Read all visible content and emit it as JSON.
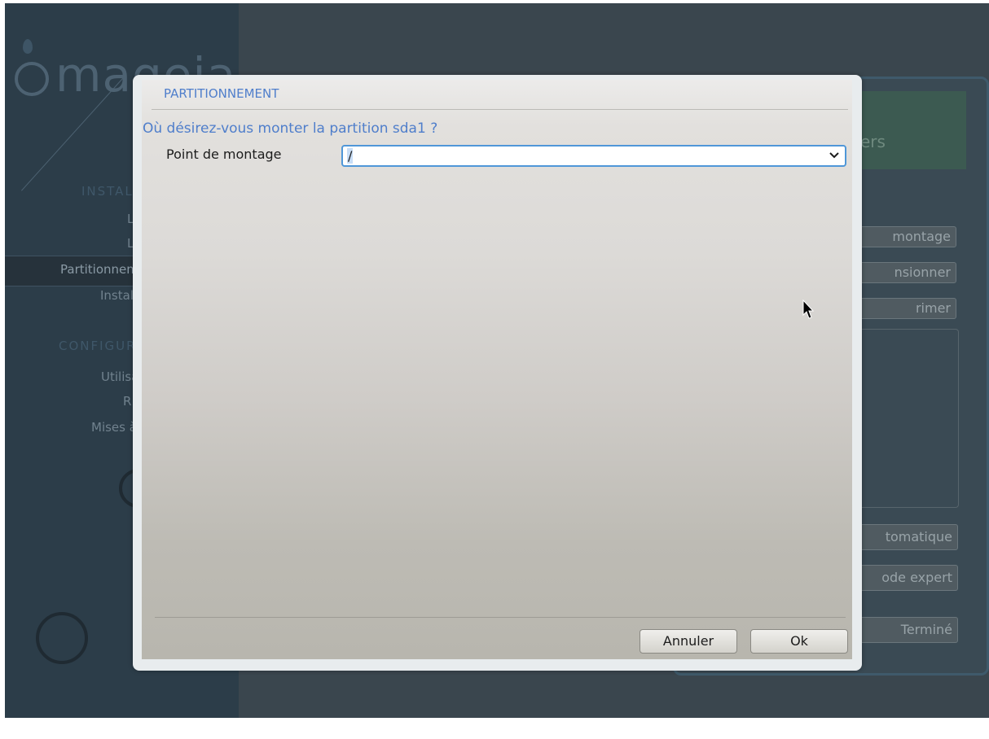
{
  "background": {
    "logo_text": "mageia",
    "sidebar_headings": [
      "INSTALLATION",
      "CONFIGURATION"
    ],
    "sidebar_items_visible": [
      "L",
      "L",
      "Partitionnement",
      "Installation",
      "Utilisateurs",
      "R",
      "Mises à jour"
    ],
    "main_header": "ers",
    "main_buttons": [
      "montage",
      "nsionner",
      "rimer",
      "tomatique",
      "ode expert",
      "Terminé"
    ]
  },
  "dialog": {
    "title": "PARTITIONNEMENT",
    "question": "Où désirez-vous monter la partition sda1 ?",
    "mount_label": "Point de montage",
    "mount_value": "/",
    "cancel_label": "Annuler",
    "ok_label": "Ok"
  },
  "colors": {
    "accent": "#4f7ecb",
    "focus": "#4f97d8"
  },
  "icons": {
    "dropdown": "chevron-down-icon",
    "pointer": "mouse-cursor-icon"
  }
}
